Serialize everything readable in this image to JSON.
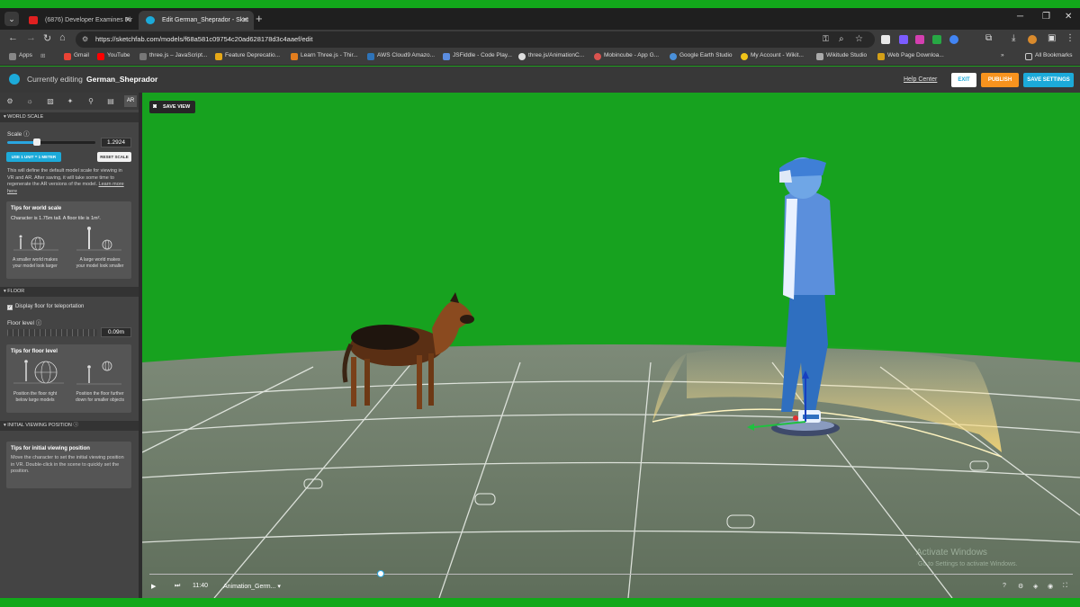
{
  "browser": {
    "tabs": [
      {
        "title": "(6876) Developer Examines Pir",
        "active": false
      },
      {
        "title": "Edit German_Sheprador - Sket",
        "active": true
      }
    ],
    "url": "https://sketchfab.com/models/f68a581c09754c20ad628178d3c4aaef/edit",
    "bookmarks": [
      "Apps",
      "Gmail",
      "YouTube",
      "three.js – JavaScript...",
      "Feature Deprecatio...",
      "Learn Three.js - Thir...",
      "AWS Cloud9 Amazo...",
      "JSFiddle - Code Play...",
      "three.js/AnimationC...",
      "Mobincube - App G...",
      "Google Earth Studio",
      "My Account - Wikit...",
      "Wikitude Studio",
      "Web Page Downloa..."
    ],
    "all_bookmarks": "All Bookmarks"
  },
  "header": {
    "editing_label": "Currently editing",
    "model_name": "German_Sheprador",
    "help_center": "Help Center",
    "exit": "EXIT",
    "publish": "PUBLISH",
    "save_settings": "SAVE SETTINGS"
  },
  "panel": {
    "ar_tab": "AR",
    "world_scale": {
      "section": "WORLD SCALE",
      "scale_label": "Scale",
      "scale_value": "1.2924",
      "scale_fraction": 0.34,
      "use_unit_button": "USE 1 UNIT = 1 METER",
      "reset_button": "RESET SCALE",
      "description": "This will define the default model scale for viewing in VR and AR. After saving, it will take some time to regenerate the AR versions of the model.",
      "learn_more": "Learn more here",
      "tips_title": "Tips for world scale",
      "tips_line": "Character is 1.75m tall. A floor tile is 1m².",
      "tip_left": "A smaller world makes your model look larger",
      "tip_right": "A large world makes your model look smaller"
    },
    "floor": {
      "section": "FLOOR",
      "display_floor": "Display floor for teleportation",
      "floor_level_label": "Floor level",
      "floor_level_value": "0.09m",
      "tips_title": "Tips for floor level",
      "tip_left": "Position the floor right below large models",
      "tip_right": "Position the floor further down for smaller objects"
    },
    "viewing": {
      "section": "INITIAL VIEWING POSITION",
      "tips_title": "Tips for initial viewing position",
      "tips_text": "Move the character to set the initial viewing position in VR. Double-click in the scene to quickly set the position."
    }
  },
  "viewport": {
    "save_view": "SAVE VIEW",
    "time": "11:40",
    "animation": "Animation_Germ...",
    "timeline_fraction": 0.25,
    "watermark_title": "Activate Windows",
    "watermark_sub": "Go to Settings to activate Windows."
  },
  "colors": {
    "accent_blue": "#1caad9",
    "publish_orange": "#f7931e",
    "green_screen": "#17a21f",
    "floor_gray": "#6b7b66"
  }
}
